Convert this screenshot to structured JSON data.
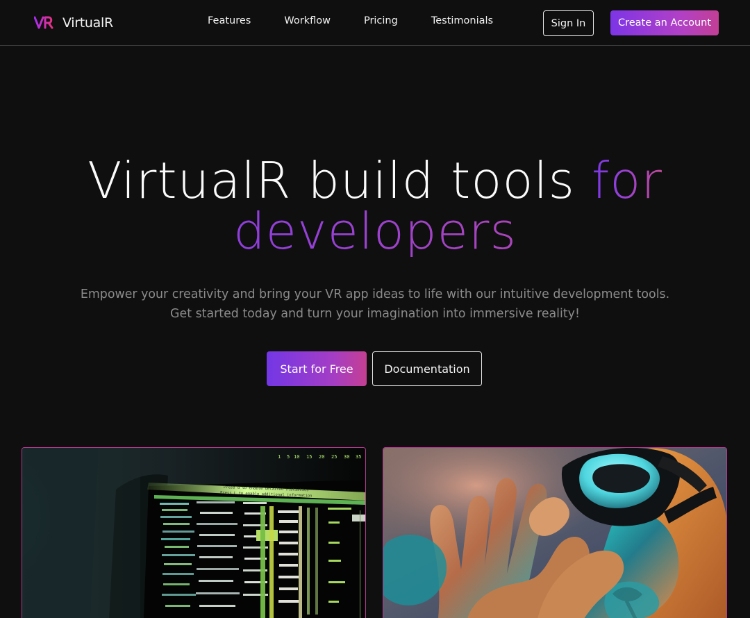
{
  "brand": {
    "name": "VirtualR",
    "logo_mark": "VR",
    "logo_gradient": [
      "#a92df0",
      "#e63283"
    ]
  },
  "nav": {
    "links": [
      "Features",
      "Workflow",
      "Pricing",
      "Testimonials"
    ],
    "sign_in": "Sign In",
    "create_account": "Create an Account"
  },
  "hero": {
    "title_plain": "VirtualR build tools",
    "title_accent_inline": "for",
    "title_accent_line": "developers",
    "subtitle_line_1": "Empower your creativity and bring your VR app ideas to life with our intuitive development tools.",
    "subtitle_line_2": "Get started today and turn your imagination into immersive reality!",
    "primary_cta": "Start for Free",
    "secondary_cta": "Documentation"
  },
  "media": [
    {
      "name": "code-terminal-image",
      "top_labels": [
        "1",
        "5",
        "10",
        "15",
        "20",
        "25",
        "30",
        "35"
      ],
      "header_text": "Press d to enable detailed statistics",
      "subheader_text": "Press L to enable additional information"
    },
    {
      "name": "vr-headset-person-image"
    }
  ],
  "colors": {
    "background": "#0f0f0f",
    "text": "#f5f5f5",
    "muted_text": "#8b8b8b",
    "accent_purple": "#7a37e6",
    "accent_pink": "#c04a98",
    "divider": "#3a3a3a"
  }
}
